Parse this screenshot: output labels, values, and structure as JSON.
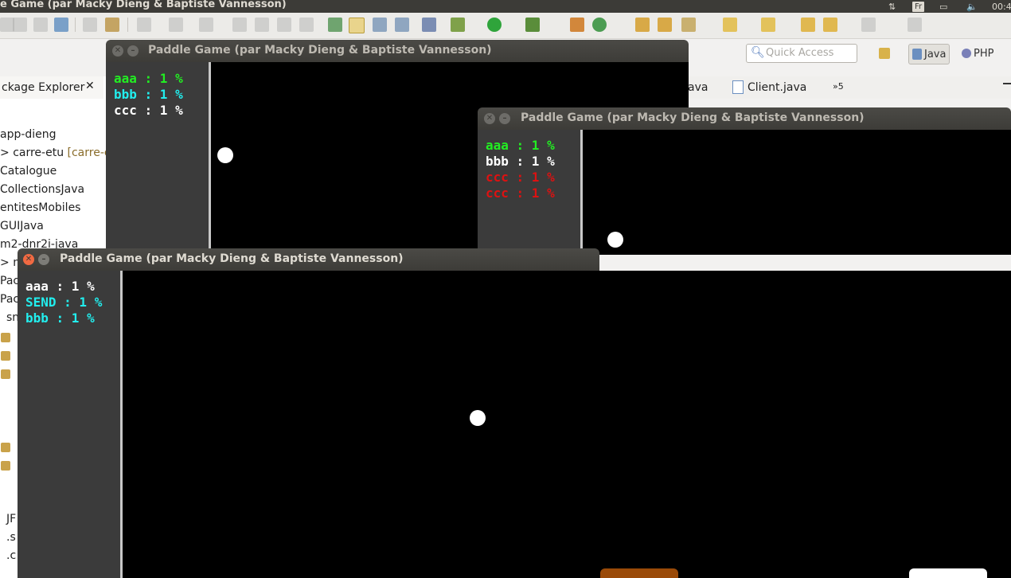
{
  "topbar": {
    "title": "e Game (par Macky Dieng & Baptiste Vannesson)",
    "lang": "Fr",
    "clock": "00:4"
  },
  "eclipse": {
    "quick_access_placeholder": "Quick Access",
    "perspectives": [
      "Java",
      "PHP"
    ],
    "package_explorer_title": "ckage Explorer",
    "package_items": [
      {
        "label": "app-dieng"
      },
      {
        "label": "carre-etu",
        "extra": "[carre-et"
      },
      {
        "label": "Catalogue"
      },
      {
        "label": "CollectionsJava"
      },
      {
        "label": "entitesMobiles"
      },
      {
        "label": "GUIJava"
      },
      {
        "label": "m2-dnr2i-java"
      },
      {
        "label": "m"
      },
      {
        "label": "Pac"
      },
      {
        "label": "Pac"
      },
      {
        "label": "sn"
      },
      {
        "label": "JF"
      },
      {
        "label": ".s"
      },
      {
        "label": ".c"
      }
    ],
    "editor_tabs": [
      "ava",
      "Client.java",
      "»5"
    ]
  },
  "windows": [
    {
      "title": "Paddle Game (par Macky Dieng & Baptiste Vannesson)",
      "scores": [
        {
          "text": "aaa : 1 %",
          "color": "#22ee22"
        },
        {
          "text": "bbb : 1 %",
          "color": "#22eeee"
        },
        {
          "text": "ccc : 1 %",
          "color": "#ffffff"
        }
      ]
    },
    {
      "title": "Paddle Game (par Macky Dieng & Baptiste Vannesson)",
      "scores": [
        {
          "text": "aaa : 1 %",
          "color": "#22ee22"
        },
        {
          "text": "bbb : 1 %",
          "color": "#ffffff"
        },
        {
          "text": "ccc : 1 %",
          "color": "#dd1111"
        },
        {
          "text": "ccc : 1 %",
          "color": "#dd1111"
        }
      ]
    },
    {
      "title": "Paddle Game (par Macky Dieng & Baptiste Vannesson)",
      "scores": [
        {
          "text": "aaa : 1 %",
          "color": "#ffffff"
        },
        {
          "text": "SEND : 1 %",
          "color": "#22eeee"
        },
        {
          "text": "bbb : 1 %",
          "color": "#22eeee"
        }
      ]
    }
  ],
  "colors": {
    "paddle_orange": "#9a4a08",
    "paddle_white": "#ffffff"
  }
}
